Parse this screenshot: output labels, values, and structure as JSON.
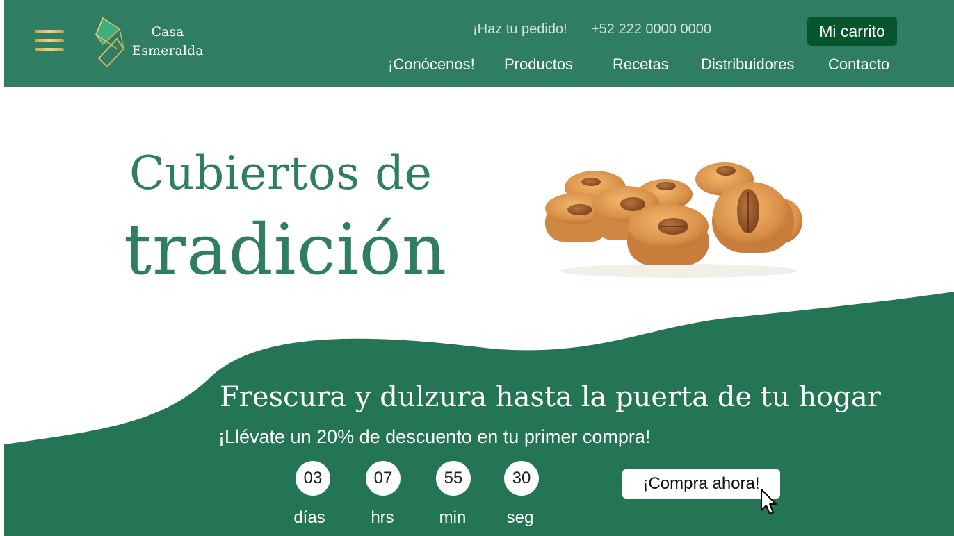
{
  "brand": {
    "line1": "Casa",
    "line2": "Esmeralda"
  },
  "topbar": {
    "order_text": "¡Haz tu pedido!",
    "phone": "+52 222 0000 0000",
    "cart_label": "Mi carrito"
  },
  "nav": {
    "items": [
      {
        "label": "¡Conócenos!"
      },
      {
        "label": "Productos"
      },
      {
        "label": "Recetas"
      },
      {
        "label": "Distribuidores"
      },
      {
        "label": "Contacto"
      }
    ]
  },
  "hero": {
    "title_line1": "Cubiertos de",
    "title_line2": "tradición"
  },
  "promo": {
    "title": "Frescura y dulzura hasta la puerta de tu hogar",
    "subtitle": "¡Llévate un 20% de descuento en tu primer compra!",
    "cta_label": "¡Compra ahora!"
  },
  "countdown": [
    {
      "value": "03",
      "unit": "días"
    },
    {
      "value": "07",
      "unit": "hrs"
    },
    {
      "value": "55",
      "unit": "min"
    },
    {
      "value": "30",
      "unit": "seg"
    }
  ],
  "colors": {
    "header_green": "#2f7d63",
    "wave_green": "#247555",
    "cart_green": "#07552f",
    "gold": "#c9a54a"
  },
  "icons": {
    "menu": "hamburger-menu-icon",
    "logo": "logo-s-diamond-icon",
    "cursor": "mouse-pointer-icon"
  }
}
